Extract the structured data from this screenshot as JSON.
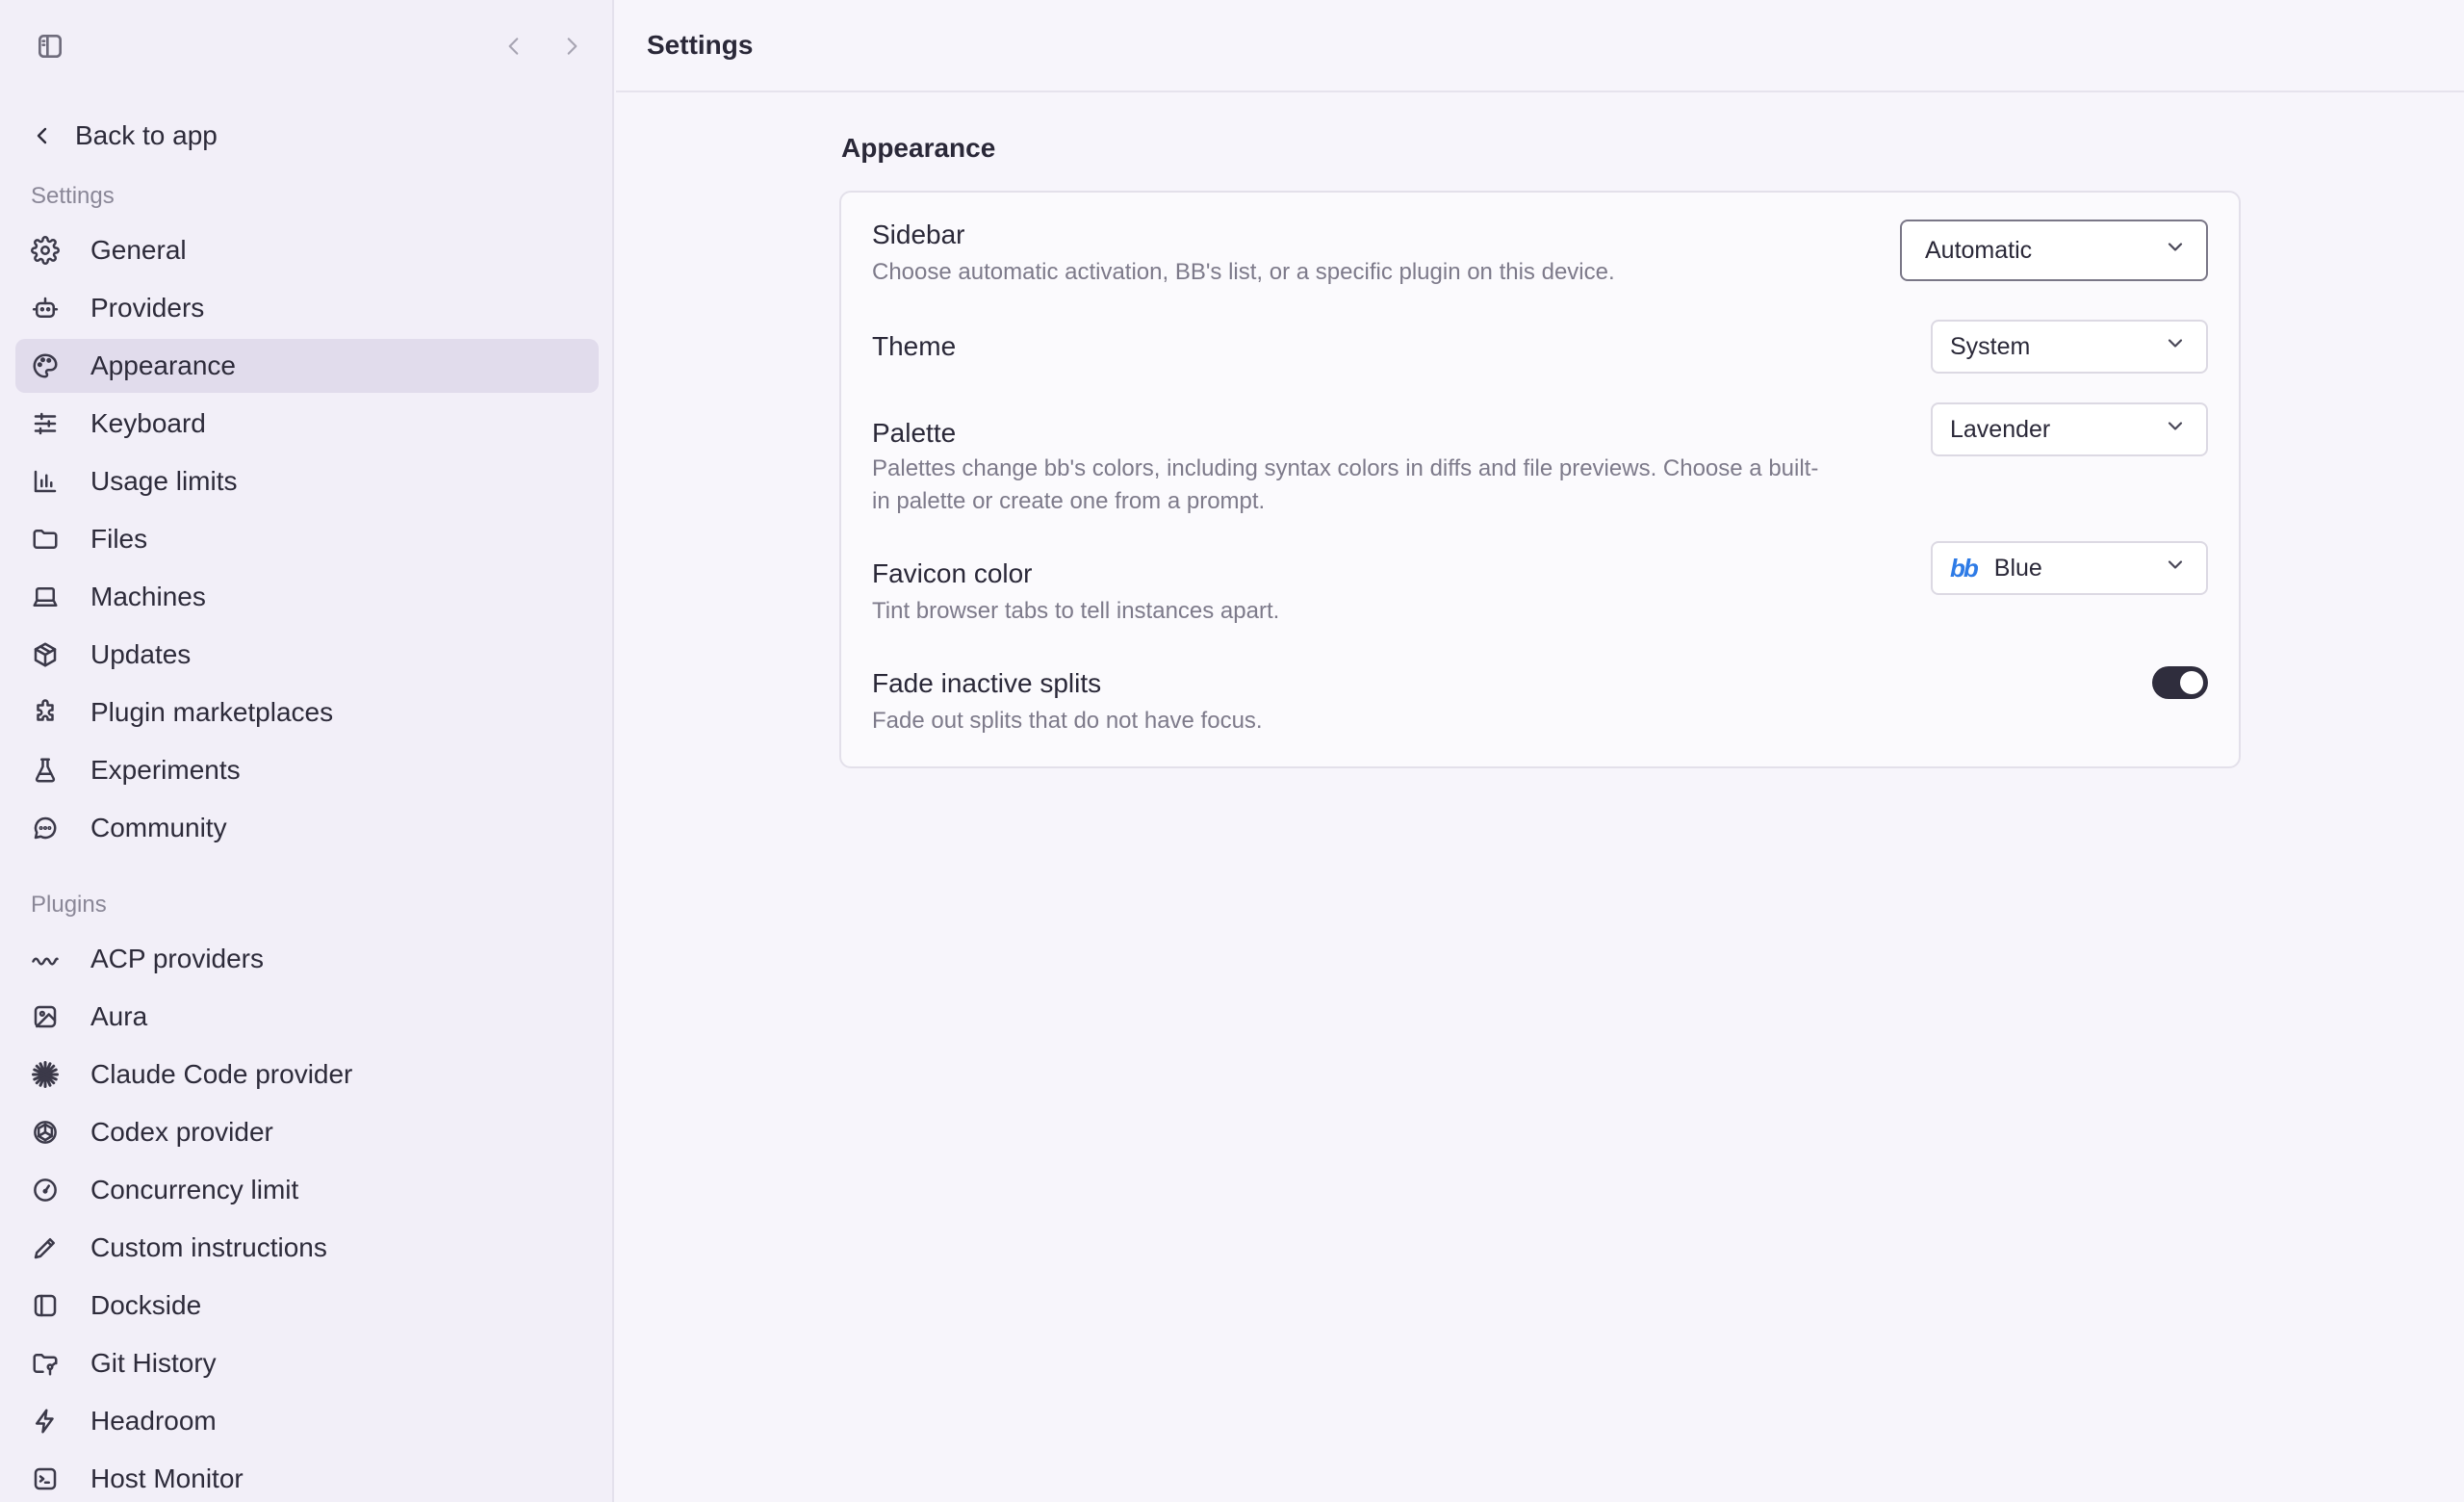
{
  "header": {
    "title": "Settings"
  },
  "sidebar": {
    "back_label": "Back to app",
    "settings_section": "Settings",
    "plugins_section": "Plugins",
    "settings_items": [
      {
        "label": "General",
        "icon": "gear-icon"
      },
      {
        "label": "Providers",
        "icon": "robot-icon"
      },
      {
        "label": "Appearance",
        "icon": "palette-icon",
        "active": true
      },
      {
        "label": "Keyboard",
        "icon": "sliders-icon"
      },
      {
        "label": "Usage limits",
        "icon": "bar-chart-icon"
      },
      {
        "label": "Files",
        "icon": "folder-icon"
      },
      {
        "label": "Machines",
        "icon": "laptop-icon"
      },
      {
        "label": "Updates",
        "icon": "package-icon"
      },
      {
        "label": "Plugin marketplaces",
        "icon": "puzzle-icon"
      },
      {
        "label": "Experiments",
        "icon": "flask-icon"
      },
      {
        "label": "Community",
        "icon": "chat-bubble-icon"
      }
    ],
    "plugin_items": [
      {
        "label": "ACP providers",
        "icon": "wave-icon"
      },
      {
        "label": "Aura",
        "icon": "image-icon"
      },
      {
        "label": "Claude Code provider",
        "icon": "starburst-icon"
      },
      {
        "label": "Codex provider",
        "icon": "openai-icon"
      },
      {
        "label": "Concurrency limit",
        "icon": "gauge-icon"
      },
      {
        "label": "Custom instructions",
        "icon": "pencil-icon"
      },
      {
        "label": "Dockside",
        "icon": "panel-left-icon"
      },
      {
        "label": "Git History",
        "icon": "folder-git-icon"
      },
      {
        "label": "Headroom",
        "icon": "lightning-icon"
      },
      {
        "label": "Host Monitor",
        "icon": "terminal-icon"
      }
    ]
  },
  "main": {
    "section_title": "Appearance",
    "settings": {
      "sidebar": {
        "title": "Sidebar",
        "desc": "Choose automatic activation, BB's list, or a specific plugin on this device.",
        "value": "Automatic"
      },
      "theme": {
        "title": "Theme",
        "value": "System"
      },
      "palette": {
        "title": "Palette",
        "desc_line1": "Palettes change bb's colors, including syntax colors in diffs and file previews. Choose a built-",
        "desc_line2": "in palette or create one from a prompt.",
        "value": "Lavender"
      },
      "favicon": {
        "title": "Favicon color",
        "desc": "Tint browser tabs to tell instances apart.",
        "value": "Blue",
        "glyph": "bb",
        "glyph_color": "#2e7be6"
      },
      "fade": {
        "title": "Fade inactive splits",
        "desc": "Fade out splits that do not have focus.",
        "enabled": true
      }
    }
  }
}
